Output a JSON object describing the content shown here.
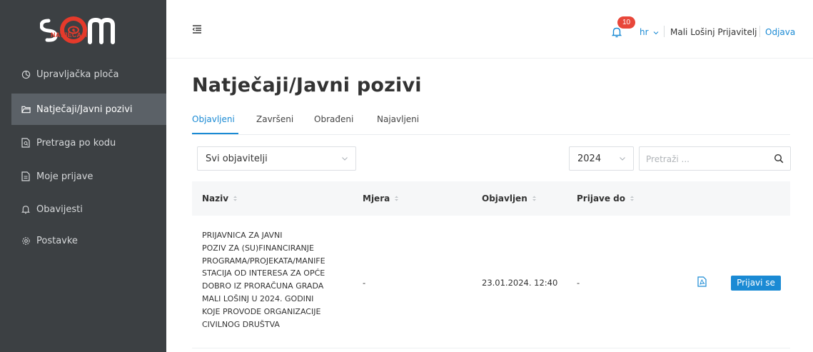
{
  "sidebar": {
    "logo_text": "NATJEČAJI",
    "items": [
      {
        "label": "Upravljačka ploča",
        "icon": "dashboard-icon"
      },
      {
        "label": "Natječaji/Javni pozivi",
        "icon": "folder-icon",
        "active": true
      },
      {
        "label": "Pretraga po kodu",
        "icon": "document-search-icon"
      },
      {
        "label": "Moje prijave",
        "icon": "document-icon"
      },
      {
        "label": "Obavijesti",
        "icon": "bell-icon"
      },
      {
        "label": "Postavke",
        "icon": "gear-icon"
      }
    ]
  },
  "header": {
    "notification_count": "10",
    "language": "hr",
    "user_name": "Mali Lošinj Prijavitelj",
    "logout_label": "Odjava"
  },
  "main": {
    "title": "Natječaji/Javni pozivi",
    "tabs": [
      {
        "label": "Objavljeni",
        "active": true
      },
      {
        "label": "Završeni"
      },
      {
        "label": "Obrađeni"
      },
      {
        "label": "Najavljeni"
      }
    ],
    "filters": {
      "publisher_value": "Svi objavitelji",
      "year_value": "2024",
      "search_placeholder": "Pretraži ..."
    },
    "table": {
      "columns": [
        "Naziv",
        "Mjera",
        "Objavljen",
        "Prijave do"
      ],
      "rows": [
        {
          "name_lines": [
            "PRIJAVNICA ZA JAVNI",
            "POZIV ZA (SU)FINANCIRANJE",
            "PROGRAMA/PROJEKATA/MANIFE",
            "STACIJA OD INTERESA ZA OPĆE",
            "DOBRO IZ PRORAČUNA GRADA",
            "MALI LOŠINJ U 2024. GODINI",
            "KOJE PROVODE ORGANIZACIJE",
            "CIVILNOG DRUŠTVA"
          ],
          "measure": "-",
          "published": "23.01.2024. 12:40",
          "deadline": "-",
          "action_label": "Prijavi se"
        }
      ]
    }
  },
  "colors": {
    "sidebar_bg": "#3c4043",
    "sidebar_active": "#5b6167",
    "accent": "#1a8ad4",
    "brand_red": "#e53a2b",
    "badge": "#e8473a"
  }
}
